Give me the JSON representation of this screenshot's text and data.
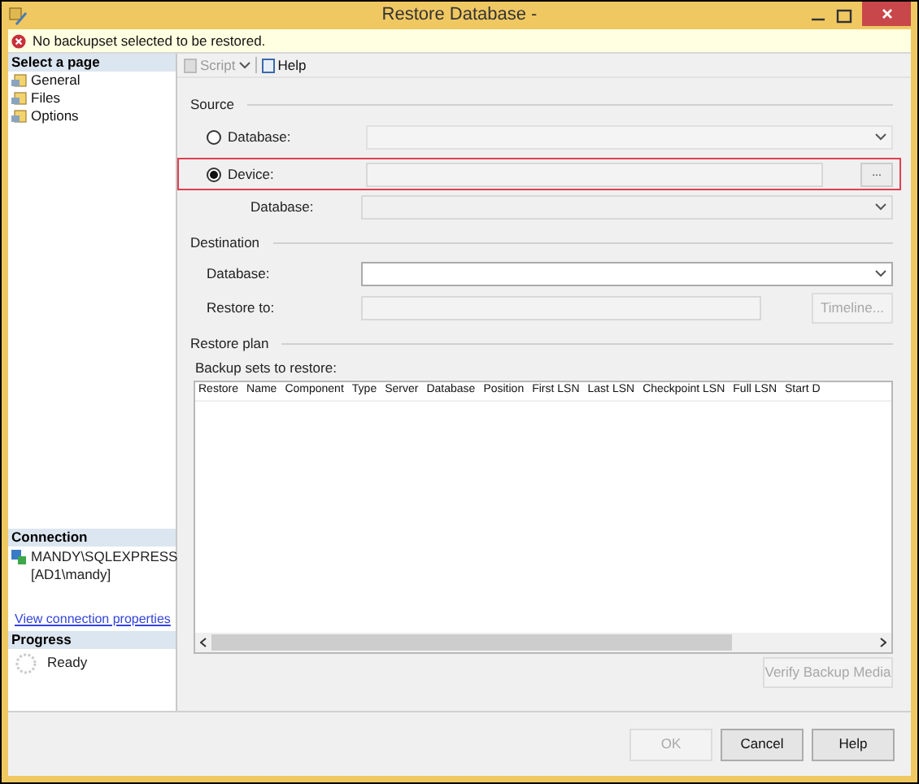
{
  "window": {
    "title": "Restore Database -"
  },
  "message": {
    "text": "No backupset selected to be restored."
  },
  "sidebar": {
    "heading": "Select a page",
    "items": [
      {
        "label": "General"
      },
      {
        "label": "Files"
      },
      {
        "label": "Options"
      }
    ]
  },
  "connection": {
    "heading": "Connection",
    "server": "MANDY\\SQLEXPRESS",
    "user": "[AD1\\mandy]",
    "link": "View connection properties"
  },
  "progress": {
    "heading": "Progress",
    "status": "Ready"
  },
  "toolbar": [
    {
      "label": "Script",
      "disabled": true
    },
    {
      "label": "Help",
      "disabled": false
    }
  ],
  "source": {
    "heading": "Source",
    "options": [
      {
        "label": "Database:",
        "selected": false
      },
      {
        "label": "Device:",
        "selected": true
      }
    ],
    "browse_button": "...",
    "database_label": "Database:"
  },
  "destination": {
    "heading": "Destination",
    "database_label": "Database:",
    "restore_to_label": "Restore to:",
    "timeline_button": {
      "label": "Timeline...",
      "disabled": true
    }
  },
  "restore_plan": {
    "heading": "Restore plan",
    "table_label": "Backup sets to restore:",
    "columns": [
      "Restore",
      "Name",
      "Component",
      "Type",
      "Server",
      "Database",
      "Position",
      "First LSN",
      "Last LSN",
      "Checkpoint LSN",
      "Full LSN",
      "Start D"
    ],
    "verify_button": {
      "label": "Verify Backup Media",
      "disabled": true
    }
  },
  "buttons": [
    {
      "label": "OK",
      "disabled": true
    },
    {
      "label": "Cancel",
      "disabled": false
    },
    {
      "label": "Help",
      "disabled": false
    }
  ]
}
